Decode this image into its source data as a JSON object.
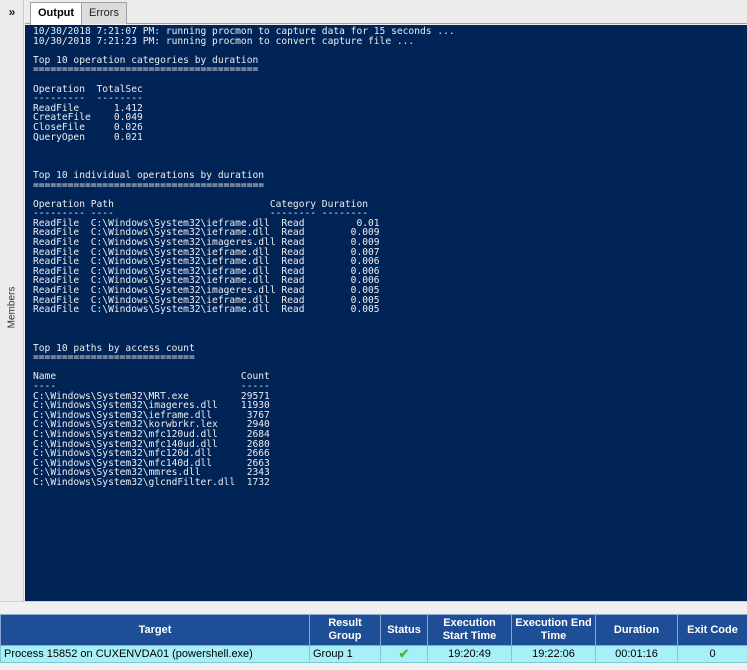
{
  "left_panel": {
    "expand_label": "»",
    "members_label": "Members"
  },
  "tabs": [
    {
      "label": "Output",
      "active": true
    },
    {
      "label": "Errors",
      "active": false
    }
  ],
  "console": {
    "background": "#012456",
    "lines": [
      "10/30/2018 7:21:07 PM: running procmon to capture data for 15 seconds ...",
      "10/30/2018 7:21:23 PM: running procmon to convert capture file ...",
      "",
      "Top 10 operation categories by duration",
      "=======================================",
      "",
      "Operation  TotalSec",
      "---------  --------",
      "ReadFile      1.412",
      "CreateFile    0.049",
      "CloseFile     0.026",
      "QueryOpen     0.021",
      "",
      "",
      "",
      "Top 10 individual operations by duration",
      "========================================",
      "",
      "Operation Path                           Category Duration",
      "--------- ----                           -------- --------",
      "ReadFile  C:\\Windows\\System32\\ieframe.dll  Read         0.01",
      "ReadFile  C:\\Windows\\System32\\ieframe.dll  Read        0.009",
      "ReadFile  C:\\Windows\\System32\\imageres.dll Read        0.009",
      "ReadFile  C:\\Windows\\System32\\ieframe.dll  Read        0.007",
      "ReadFile  C:\\Windows\\System32\\ieframe.dll  Read        0.006",
      "ReadFile  C:\\Windows\\System32\\ieframe.dll  Read        0.006",
      "ReadFile  C:\\Windows\\System32\\ieframe.dll  Read        0.006",
      "ReadFile  C:\\Windows\\System32\\imageres.dll Read        0.005",
      "ReadFile  C:\\Windows\\System32\\ieframe.dll  Read        0.005",
      "ReadFile  C:\\Windows\\System32\\ieframe.dll  Read        0.005",
      "",
      "",
      "",
      "Top 10 paths by access count",
      "============================",
      "",
      "Name                                Count",
      "----                                -----",
      "C:\\Windows\\System32\\MRT.exe         29571",
      "C:\\Windows\\System32\\imageres.dll    11930",
      "C:\\Windows\\System32\\ieframe.dll      3767",
      "C:\\Windows\\System32\\korwbrkr.lex     2940",
      "C:\\Windows\\System32\\mfc120ud.dll     2684",
      "C:\\Windows\\System32\\mfc140ud.dll     2680",
      "C:\\Windows\\System32\\mfc120d.dll      2666",
      "C:\\Windows\\System32\\mfc140d.dll      2663",
      "C:\\Windows\\System32\\mmres.dll        2343",
      "C:\\Windows\\System32\\glcndFilter.dll  1732"
    ]
  },
  "results": {
    "columns": [
      "Target",
      "Result Group",
      "Status",
      "Execution Start Time",
      "Execution End Time",
      "Duration",
      "Exit Code"
    ],
    "rows": [
      {
        "target": "Process 15852 on CUXENVDA01 (powershell.exe)",
        "result_group": "Group 1",
        "status_icon": "check-icon",
        "start_time": "19:20:49",
        "end_time": "19:22:06",
        "duration": "00:01:16",
        "exit_code": "0"
      }
    ]
  }
}
